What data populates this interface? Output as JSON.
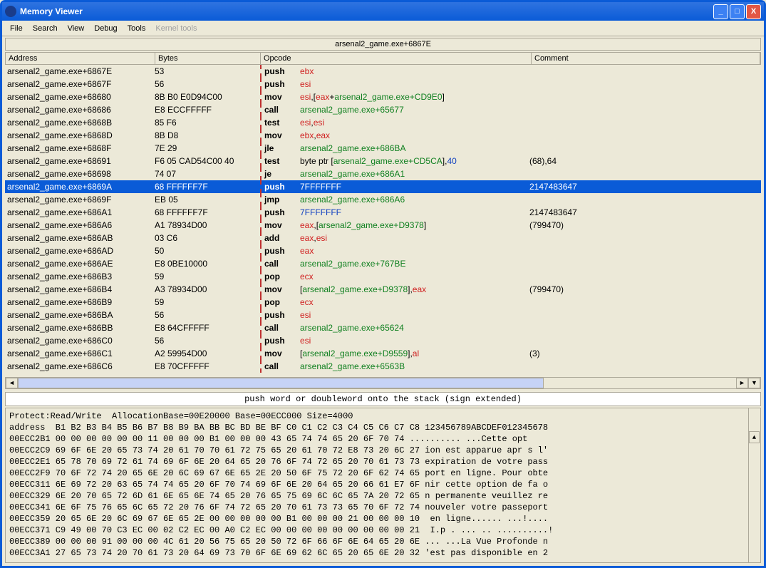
{
  "window": {
    "title": "Memory Viewer"
  },
  "menu": {
    "file": "File",
    "search": "Search",
    "view": "View",
    "debug": "Debug",
    "tools": "Tools",
    "kernel": "Kernel tools"
  },
  "location": "arsenal2_game.exe+6867E",
  "columns": {
    "addr": "Address",
    "bytes": "Bytes",
    "op": "Opcode",
    "com": "Comment"
  },
  "rows": [
    {
      "addr": "arsenal2_game.exe+6867E",
      "bytes": "53",
      "op": "push",
      "arg": [
        {
          "t": "reg",
          "v": "ebx"
        }
      ],
      "com": ""
    },
    {
      "addr": "arsenal2_game.exe+6867F",
      "bytes": "56",
      "op": "push",
      "arg": [
        {
          "t": "reg",
          "v": "esi"
        }
      ],
      "com": ""
    },
    {
      "addr": "arsenal2_game.exe+68680",
      "bytes": "8B B0 E0D94C00",
      "op": "mov",
      "arg": [
        {
          "t": "reg",
          "v": "esi"
        },
        {
          "t": "txt",
          "v": ",["
        },
        {
          "t": "reg",
          "v": "eax"
        },
        {
          "t": "txt",
          "v": "+"
        },
        {
          "t": "sym",
          "v": "arsenal2_game.exe+CD9E0"
        },
        {
          "t": "txt",
          "v": "]"
        }
      ],
      "com": ""
    },
    {
      "addr": "arsenal2_game.exe+68686",
      "bytes": "E8 ECCFFFFF",
      "op": "call",
      "arg": [
        {
          "t": "sym",
          "v": "arsenal2_game.exe+65677"
        }
      ],
      "com": ""
    },
    {
      "addr": "arsenal2_game.exe+6868B",
      "bytes": "85 F6",
      "op": "test",
      "arg": [
        {
          "t": "reg",
          "v": "esi"
        },
        {
          "t": "txt",
          "v": ","
        },
        {
          "t": "reg",
          "v": "esi"
        }
      ],
      "com": ""
    },
    {
      "addr": "arsenal2_game.exe+6868D",
      "bytes": "8B D8",
      "op": "mov",
      "arg": [
        {
          "t": "reg",
          "v": "ebx"
        },
        {
          "t": "txt",
          "v": ","
        },
        {
          "t": "reg",
          "v": "eax"
        }
      ],
      "com": ""
    },
    {
      "addr": "arsenal2_game.exe+6868F",
      "bytes": "7E 29",
      "op": "jle",
      "arg": [
        {
          "t": "sym",
          "v": "arsenal2_game.exe+686BA"
        }
      ],
      "com": ""
    },
    {
      "addr": "arsenal2_game.exe+68691",
      "bytes": "F6 05 CAD54C00 40",
      "op": "test",
      "arg": [
        {
          "t": "txt",
          "v": "byte ptr ["
        },
        {
          "t": "sym",
          "v": "arsenal2_game.exe+CD5CA"
        },
        {
          "t": "txt",
          "v": "],"
        },
        {
          "t": "num",
          "v": "40"
        }
      ],
      "com": "(68),64"
    },
    {
      "addr": "arsenal2_game.exe+68698",
      "bytes": "74 07",
      "op": "je",
      "arg": [
        {
          "t": "sym",
          "v": "arsenal2_game.exe+686A1"
        }
      ],
      "com": ""
    },
    {
      "addr": "arsenal2_game.exe+6869A",
      "bytes": "68 FFFFFF7F",
      "op": "push",
      "arg": [
        {
          "t": "num",
          "v": "7FFFFFFF"
        }
      ],
      "com": "2147483647",
      "sel": true
    },
    {
      "addr": "arsenal2_game.exe+6869F",
      "bytes": "EB 05",
      "op": "jmp",
      "arg": [
        {
          "t": "sym",
          "v": "arsenal2_game.exe+686A6"
        }
      ],
      "com": ""
    },
    {
      "addr": "arsenal2_game.exe+686A1",
      "bytes": "68 FFFFFF7F",
      "op": "push",
      "arg": [
        {
          "t": "num",
          "v": "7FFFFFFF"
        }
      ],
      "com": "2147483647"
    },
    {
      "addr": "arsenal2_game.exe+686A6",
      "bytes": "A1 78934D00",
      "op": "mov",
      "arg": [
        {
          "t": "reg",
          "v": "eax"
        },
        {
          "t": "txt",
          "v": ",["
        },
        {
          "t": "sym",
          "v": "arsenal2_game.exe+D9378"
        },
        {
          "t": "txt",
          "v": "]"
        }
      ],
      "com": "(799470)"
    },
    {
      "addr": "arsenal2_game.exe+686AB",
      "bytes": "03 C6",
      "op": "add",
      "arg": [
        {
          "t": "reg",
          "v": "eax"
        },
        {
          "t": "txt",
          "v": ","
        },
        {
          "t": "reg",
          "v": "esi"
        }
      ],
      "com": ""
    },
    {
      "addr": "arsenal2_game.exe+686AD",
      "bytes": "50",
      "op": "push",
      "arg": [
        {
          "t": "reg",
          "v": "eax"
        }
      ],
      "com": ""
    },
    {
      "addr": "arsenal2_game.exe+686AE",
      "bytes": "E8 0BE10000",
      "op": "call",
      "arg": [
        {
          "t": "sym",
          "v": "arsenal2_game.exe+767BE"
        }
      ],
      "com": ""
    },
    {
      "addr": "arsenal2_game.exe+686B3",
      "bytes": "59",
      "op": "pop",
      "arg": [
        {
          "t": "reg",
          "v": "ecx"
        }
      ],
      "com": ""
    },
    {
      "addr": "arsenal2_game.exe+686B4",
      "bytes": "A3 78934D00",
      "op": "mov",
      "arg": [
        {
          "t": "txt",
          "v": "["
        },
        {
          "t": "sym",
          "v": "arsenal2_game.exe+D9378"
        },
        {
          "t": "txt",
          "v": "],"
        },
        {
          "t": "reg",
          "v": "eax"
        }
      ],
      "com": "(799470)"
    },
    {
      "addr": "arsenal2_game.exe+686B9",
      "bytes": "59",
      "op": "pop",
      "arg": [
        {
          "t": "reg",
          "v": "ecx"
        }
      ],
      "com": ""
    },
    {
      "addr": "arsenal2_game.exe+686BA",
      "bytes": "56",
      "op": "push",
      "arg": [
        {
          "t": "reg",
          "v": "esi"
        }
      ],
      "com": ""
    },
    {
      "addr": "arsenal2_game.exe+686BB",
      "bytes": "E8 64CFFFFF",
      "op": "call",
      "arg": [
        {
          "t": "sym",
          "v": "arsenal2_game.exe+65624"
        }
      ],
      "com": ""
    },
    {
      "addr": "arsenal2_game.exe+686C0",
      "bytes": "56",
      "op": "push",
      "arg": [
        {
          "t": "reg",
          "v": "esi"
        }
      ],
      "com": ""
    },
    {
      "addr": "arsenal2_game.exe+686C1",
      "bytes": "A2 59954D00",
      "op": "mov",
      "arg": [
        {
          "t": "txt",
          "v": "["
        },
        {
          "t": "sym",
          "v": "arsenal2_game.exe+D9559"
        },
        {
          "t": "txt",
          "v": "],"
        },
        {
          "t": "reg",
          "v": "al"
        }
      ],
      "com": "(3)"
    },
    {
      "addr": "arsenal2_game.exe+686C6",
      "bytes": "E8 70CFFFFF",
      "op": "call",
      "arg": [
        {
          "t": "sym",
          "v": "arsenal2_game.exe+6563B"
        }
      ],
      "com": ""
    }
  ],
  "info": "push word or doubleword onto the stack (sign extended)",
  "hex_header1": "Protect:Read/Write  AllocationBase=00E20000 Base=00ECC000 Size=4000",
  "hex_header2": "address  B1 B2 B3 B4 B5 B6 B7 B8 B9 BA BB BC BD BE BF C0 C1 C2 C3 C4 C5 C6 C7 C8 123456789ABCDEF012345678",
  "hex_rows": [
    "00ECC2B1 00 00 00 00 00 00 11 00 00 00 B1 00 00 00 43 65 74 74 65 20 6F 70 74 .......... ...Cette opt",
    "00ECC2C9 69 6F 6E 20 65 73 74 20 61 70 70 61 72 75 65 20 61 70 72 E8 73 20 6C 27 ion est apparue apr s l'",
    "00ECC2E1 65 78 70 69 72 61 74 69 6F 6E 20 64 65 20 76 6F 74 72 65 20 70 61 73 73 expiration de votre pass",
    "00ECC2F9 70 6F 72 74 20 65 6E 20 6C 69 67 6E 65 2E 20 50 6F 75 72 20 6F 62 74 65 port en ligne. Pour obte",
    "00ECC311 6E 69 72 20 63 65 74 74 65 20 6F 70 74 69 6F 6E 20 64 65 20 66 61 E7 6F nir cette option de fa o",
    "00ECC329 6E 20 70 65 72 6D 61 6E 65 6E 74 65 20 76 65 75 69 6C 6C 65 7A 20 72 65 n permanente veuillez re",
    "00ECC341 6E 6F 75 76 65 6C 65 72 20 76 6F 74 72 65 20 70 61 73 73 65 70 6F 72 74 nouveler votre passeport",
    "00ECC359 20 65 6E 20 6C 69 67 6E 65 2E 00 00 00 00 00 B1 00 00 00 21 00 00 00 10  en ligne...... ...!....",
    "00ECC371 C9 49 00 70 C3 EC 00 02 C2 EC 00 A0 C2 EC 00 00 00 00 00 00 00 00 00 21  I.p . ... .. ..........!",
    "00ECC389 00 00 00 91 00 00 00 4C 61 20 56 75 65 20 50 72 6F 66 6F 6E 64 65 20 6E ... ...La Vue Profonde n",
    "00ECC3A1 27 65 73 74 20 70 61 73 20 64 69 73 70 6F 6E 69 62 6C 65 20 65 6E 20 32 'est pas disponible en 2"
  ]
}
